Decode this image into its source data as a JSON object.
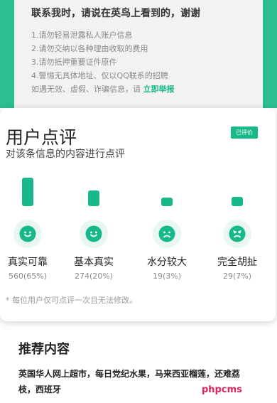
{
  "notice": {
    "title": "联系我时，请说在英鸟上看到的，谢谢",
    "lines": [
      "1.请勿轻易泄露私人账户信息",
      "2.请勿交纳以各种理由收取的费用",
      "3.请勿抵押重要证件原件",
      "4.警惕无具体地址、仅以QQ联系的招聘"
    ],
    "last_line_prefix": "如遇无效、虚假、诈骗信息，请",
    "report_link": "立即举报"
  },
  "rating": {
    "title": "用户点评",
    "subtitle": "对该条信息的内容进行点评",
    "badge": "已评价",
    "options": [
      {
        "label": "真实可靠",
        "count": "560(65%)",
        "icon": "smile-face-icon",
        "mood": "happy",
        "value": 65
      },
      {
        "label": "基本真实",
        "count": "274(20%)",
        "icon": "smile-face-icon",
        "mood": "happy",
        "value": 20
      },
      {
        "label": "水分较大",
        "count": "19(3%)",
        "icon": "sad-face-icon",
        "mood": "sad",
        "value": 3
      },
      {
        "label": "完全胡扯",
        "count": "29(7%)",
        "icon": "angry-face-icon",
        "mood": "angry",
        "value": 7
      }
    ],
    "footnote": "* 每位用户仅可点评一次且无法修改。"
  },
  "recommend": {
    "title": "推荐内容",
    "item": "英国华人网上超市，每日党纪水果，马来西亚榴莲，还难荔枝，西班牙"
  },
  "watermark": "phpcms",
  "colors": {
    "accent": "#17b889",
    "watermark": "#e0245e"
  }
}
